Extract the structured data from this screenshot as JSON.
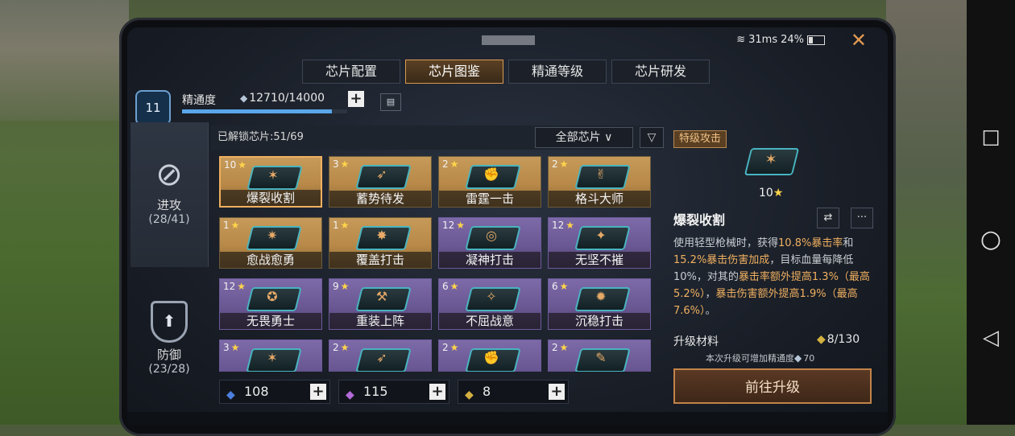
{
  "status_bar": {
    "ping": "31ms",
    "battery": "24%"
  },
  "tabs": [
    {
      "label": "芯片配置",
      "active": false
    },
    {
      "label": "芯片图鉴",
      "active": true
    },
    {
      "label": "精通等级",
      "active": false
    },
    {
      "label": "芯片研发",
      "active": false
    }
  ],
  "mastery": {
    "rank": "11",
    "label": "精通度",
    "value": "12710/14000",
    "progress": 0.908
  },
  "categories": {
    "attack": {
      "label": "进攻",
      "count": "(28/41)"
    },
    "defense": {
      "label": "防御",
      "count": "(23/28)"
    }
  },
  "panel": {
    "unlocked": "已解锁芯片:51/69",
    "filter": "全部芯片"
  },
  "chips": [
    {
      "level": "10",
      "name": "爆裂收割",
      "glyph": "✶",
      "rarity": "gold",
      "selected": true
    },
    {
      "level": "3",
      "name": "蓄势待发",
      "glyph": "➶",
      "rarity": "gold"
    },
    {
      "level": "2",
      "name": "雷霆一击",
      "glyph": "✊",
      "rarity": "gold"
    },
    {
      "level": "2",
      "name": "格斗大师",
      "glyph": "✌",
      "rarity": "gold"
    },
    {
      "level": "1",
      "name": "愈战愈勇",
      "glyph": "✷",
      "rarity": "gold"
    },
    {
      "level": "1",
      "name": "覆盖打击",
      "glyph": "✸",
      "rarity": "gold"
    },
    {
      "level": "12",
      "name": "凝神打击",
      "glyph": "◎",
      "rarity": "purple"
    },
    {
      "level": "12",
      "name": "无坚不摧",
      "glyph": "✦",
      "rarity": "purple"
    },
    {
      "level": "12",
      "name": "无畏勇士",
      "glyph": "✪",
      "rarity": "purple"
    },
    {
      "level": "9",
      "name": "重装上阵",
      "glyph": "⚒",
      "rarity": "purple"
    },
    {
      "level": "6",
      "name": "不屈战意",
      "glyph": "✧",
      "rarity": "purple"
    },
    {
      "level": "6",
      "name": "沉稳打击",
      "glyph": "✹",
      "rarity": "purple"
    },
    {
      "level": "3",
      "name": "",
      "glyph": "✶",
      "rarity": "purple"
    },
    {
      "level": "2",
      "name": "",
      "glyph": "➶",
      "rarity": "purple"
    },
    {
      "level": "2",
      "name": "",
      "glyph": "✊",
      "rarity": "purple"
    },
    {
      "level": "2",
      "name": "",
      "glyph": "✎",
      "rarity": "purple"
    }
  ],
  "resources": [
    {
      "value": "108",
      "icon": "blue-gem",
      "color": "#4d7fe0"
    },
    {
      "value": "115",
      "icon": "purple-gem",
      "color": "#b46ad8"
    },
    {
      "value": "8",
      "icon": "gold-gem",
      "color": "#d4b040"
    }
  ],
  "detail": {
    "tag": "特级攻击",
    "level": "10",
    "name": "爆裂收割",
    "desc": {
      "t1": "使用轻型枪械时，获得",
      "h1": "10.8%暴击率",
      "t2": "和",
      "h2": "15.2%暴击伤害加成",
      "t3": "，目标血量每降低10%，对其的",
      "h3": "暴击率额外提高1.3%（最高5.2%）",
      "t4": "，",
      "h4": "暴击伤害额外提高1.9%（最高7.6%）",
      "t5": "。"
    },
    "upgrade_label": "升级材料",
    "upgrade_count": "8/130",
    "upgrade_note": "本次升级可增加精通度",
    "upgrade_bonus": "70",
    "go_button": "前往升级"
  }
}
